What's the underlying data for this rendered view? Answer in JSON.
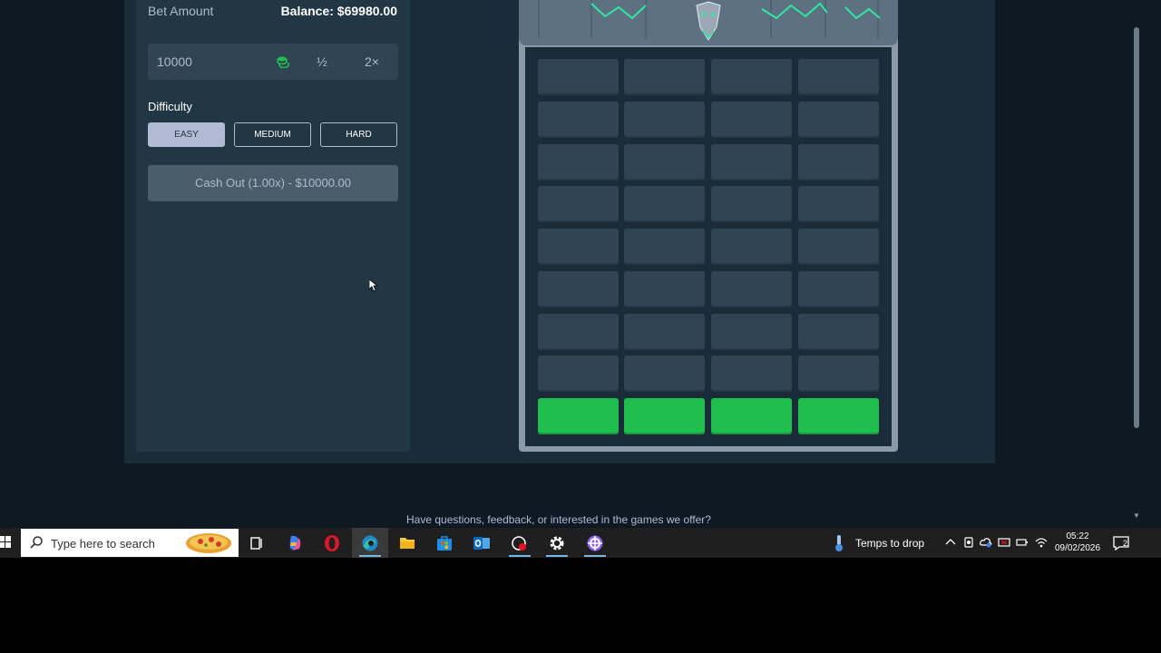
{
  "panel": {
    "bet_label": "Bet Amount",
    "balance": "Balance: $69980.00",
    "bet_value": "10000",
    "half_label": "½",
    "double_label": "2×",
    "difficulty_label": "Difficulty",
    "difficulty_options": [
      "EASY",
      "MEDIUM",
      "HARD"
    ],
    "selected_difficulty": "EASY",
    "cashout_label": "Cash Out (1.00x) - $10000.00"
  },
  "tower": {
    "columns": 4,
    "rows": 9,
    "safe_row": 9,
    "colors": {
      "tile": "#2f4553",
      "safe": "#1fbe4f",
      "tower": "#8b9aa6"
    }
  },
  "footer": {
    "text": "Have questions, feedback, or interested in the games we offer?"
  },
  "taskbar": {
    "search_placeholder": "Type here to search",
    "weather_text": "Temps to drop",
    "time": "05:22",
    "date": "09/02/2026",
    "notification_count": "2",
    "apps": [
      "task-view",
      "copilot",
      "opera",
      "edge",
      "file-explorer",
      "microsoft-store",
      "outlook",
      "recorder",
      "settings",
      "game-app"
    ]
  }
}
